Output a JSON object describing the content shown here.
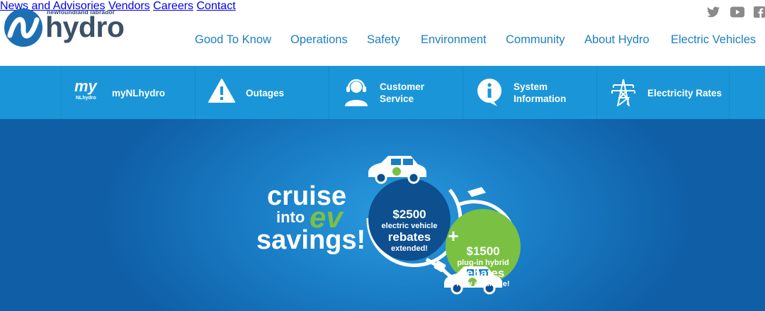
{
  "brand": {
    "logo_sub": "newfoundland labrador",
    "logo_word": "hydro"
  },
  "utility_nav": {
    "items": [
      "News and Advisories",
      "Vendors",
      "Careers",
      "Contact"
    ],
    "social": [
      "twitter-icon",
      "youtube-icon",
      "facebook-icon"
    ]
  },
  "main_nav": {
    "items": [
      "Good To Know",
      "Operations",
      "Safety",
      "Environment",
      "Community",
      "About Hydro",
      "Electric Vehicles"
    ]
  },
  "quick_links": {
    "items": [
      {
        "icon": "my-nlhydro-icon",
        "line1": "myNLhydro",
        "line2": "",
        "icon_text_top": "my",
        "icon_text_bottom": "NLhydro"
      },
      {
        "icon": "warning-icon",
        "line1": "Outages",
        "line2": ""
      },
      {
        "icon": "headset-icon",
        "line1": "Customer",
        "line2": "Service"
      },
      {
        "icon": "info-icon",
        "line1": "System",
        "line2": "Information"
      },
      {
        "icon": "power-tower-icon",
        "line1": "Electricity Rates",
        "line2": ""
      }
    ]
  },
  "hero": {
    "line_cruise": "cruise",
    "line_into": "into",
    "line_ev": "ev",
    "line_savings": "savings!",
    "badge1": {
      "amount": "$2500",
      "line1": "electric vehicle",
      "line2": "rebates",
      "line3": "extended!"
    },
    "plus": "+",
    "badge2": {
      "amount": "$1500",
      "line1": "plug-in hybrid",
      "line2": "rebates",
      "line3": "now available!"
    }
  },
  "colors": {
    "nav_blue": "#1d80c3",
    "bar_blue": "#1a96d8",
    "hero_dark": "#0f5ea6",
    "ev_green": "#7ac143",
    "badge_dark": "#0d4f8f"
  }
}
